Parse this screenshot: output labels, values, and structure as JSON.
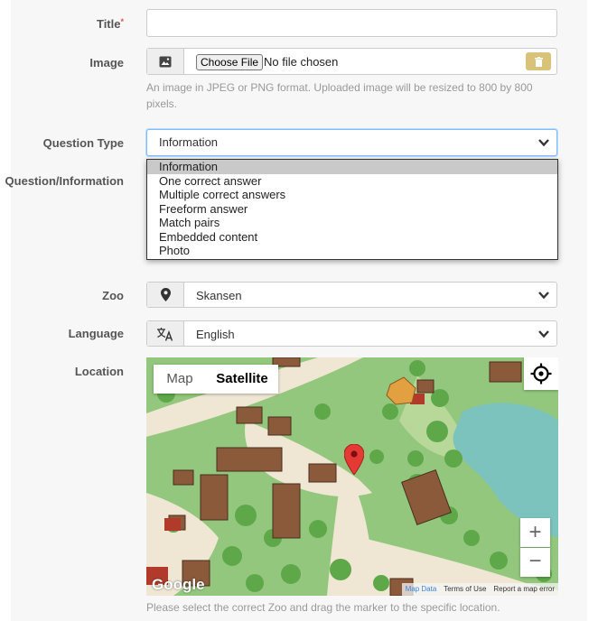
{
  "form": {
    "title": {
      "label": "Title",
      "required_mark": "*",
      "value": ""
    },
    "image": {
      "label": "Image",
      "choose_button": "Choose File",
      "file_status": "No file chosen",
      "help": "An image in JPEG or PNG format. Uploaded image will be resized to 800 by 800 pixels."
    },
    "question_type": {
      "label": "Question Type",
      "selected": "Information",
      "options": [
        "Information",
        "One correct answer",
        "Multiple correct answers",
        "Freeform answer",
        "Match pairs",
        "Embedded content",
        "Photo"
      ]
    },
    "question_information": {
      "label": "Question/Information"
    },
    "zoo": {
      "label": "Zoo",
      "selected": "Skansen"
    },
    "language": {
      "label": "Language",
      "selected": "English"
    },
    "location": {
      "label": "Location",
      "help": "Please select the correct Zoo and drag the marker to the specific location."
    }
  },
  "map": {
    "type_map": "Map",
    "type_satellite": "Satellite",
    "zoom_in": "+",
    "zoom_out": "−",
    "google_logo": "Google",
    "map_data": "Map Data",
    "terms": "Terms of Use",
    "report": "Report a map error",
    "marker_color": "#e53935"
  },
  "colors": {
    "accent": "#80bdff",
    "delete_button": "#d9c27a",
    "required": "#d9534f"
  }
}
